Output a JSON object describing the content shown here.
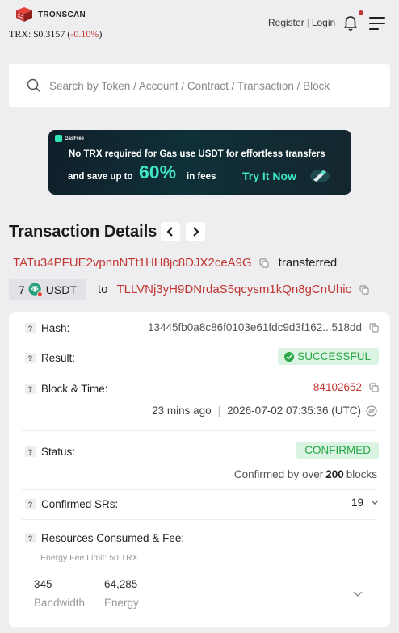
{
  "header": {
    "logo_text": "TRONSCAN",
    "price_label": "TRX: $0.3157 (",
    "price_change": "-0.10%",
    "price_close": ")",
    "register_label": "Register",
    "login_label": "Login"
  },
  "search": {
    "placeholder": "Search by Token / Account / Contract / Transaction / Block"
  },
  "banner": {
    "brand": "GasFree",
    "line1": "No TRX required for Gas use USDT for effortless transfers",
    "line2": "and save up to",
    "percent": "60%",
    "suffix": "in fees",
    "cta": "Try It Now"
  },
  "page": {
    "title": "Transaction Details"
  },
  "summary": {
    "from_address": "TATu34PFUE2vpnnNTt1HH8jc8DJX2ceA9G",
    "transferred_label": "transferred",
    "amount": "7",
    "token": "USDT",
    "to_label": "to",
    "to_address": "TLLVNj3yH9DNrdaS5qcysm1kQn8gCnUhic"
  },
  "details": {
    "hash_label": "Hash:",
    "hash_value": "13445fb0a8c86f0103e61fdc9d3f162...518dd",
    "result_label": "Result:",
    "result_value": "SUCCESSFUL",
    "block_label": "Block & Time:",
    "block_value": "84102652",
    "time_ago": "23 mins ago",
    "timestamp": "2026-07-02 07:35:36 (UTC)",
    "status_label": "Status:",
    "status_value": "CONFIRMED",
    "confirmed_prefix": "Confirmed by over ",
    "confirmed_count": "200",
    "confirmed_suffix": " blocks",
    "srs_label": "Confirmed SRs:",
    "srs_value": "19",
    "resources_label": "Resources Consumed & Fee:",
    "energy_limit": "Energy Fee Limit: 50 TRX",
    "bandwidth_value": "345",
    "bandwidth_label": "Bandwidth",
    "energy_value": "64,285",
    "energy_label": "Energy"
  },
  "colors": {
    "accent_red": "#c23631",
    "success_green": "#28a745",
    "banner_teal": "#3fe6c8"
  }
}
